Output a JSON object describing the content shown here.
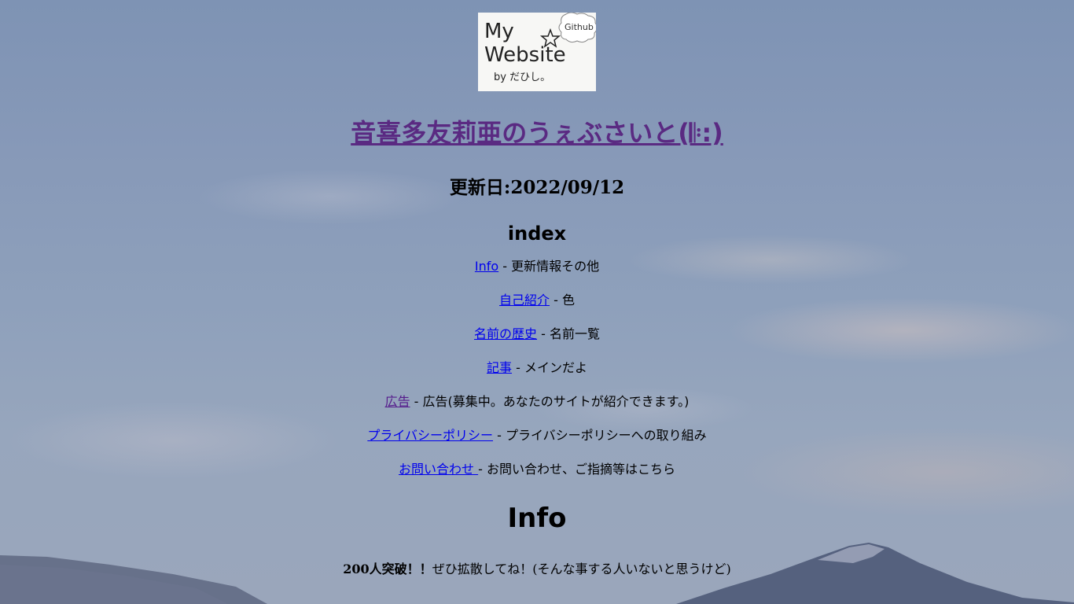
{
  "logo": {
    "line1": "My",
    "badge": "Github",
    "line2": "Website",
    "line3": "by だひし。"
  },
  "site_title": "音喜多友莉亜のうぇぶさいと(𝄆:)",
  "updated": "更新日:2022/09/12",
  "index_heading": "index",
  "index_items": [
    {
      "link": "Info",
      "desc": " - 更新情報その他"
    },
    {
      "link": "自己紹介",
      "desc": " - 色"
    },
    {
      "link": "名前の歴史",
      "desc": " - 名前一覧"
    },
    {
      "link": "記事",
      "desc": " - メインだよ"
    },
    {
      "link": "広告",
      "desc": " - 広告(募集中。あなたのサイトが紹介できます。)"
    },
    {
      "link": "プライバシーポリシー",
      "desc": " - プライバシーポリシーへの取り組み"
    },
    {
      "link": "お問い合わせ ",
      "desc": " - お問い合わせ、ご指摘等はこちら"
    }
  ],
  "info_heading": "Info",
  "info": {
    "bold": "200人突破！！",
    "text": "ぜひ拡散してね！(そんな事する人いないと思うけど)"
  },
  "colors": {
    "link": "#0000ee",
    "visited_link": "#551a8b",
    "title_link": "#5a2a82",
    "sky_top": "#7e93b4",
    "sky_bottom": "#9aa6bb"
  }
}
